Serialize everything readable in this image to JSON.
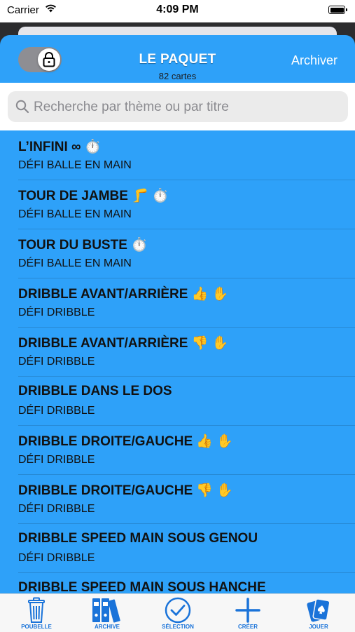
{
  "status_bar": {
    "carrier": "Carrier",
    "time": "4:09 PM"
  },
  "header": {
    "title": "LE PAQUET",
    "subtitle": "82 cartes",
    "archive_label": "Archiver",
    "lock_toggle_on": true
  },
  "search": {
    "placeholder": "Recherche par thème ou par titre"
  },
  "cards": [
    {
      "title": "L’INFINI ∞",
      "emoji": "⏱️",
      "category": "DÉFI BALLE EN MAIN"
    },
    {
      "title": "TOUR DE JAMBE",
      "emoji": "🦵 ⏱️",
      "category": "DÉFI BALLE EN MAIN"
    },
    {
      "title": "TOUR DU BUSTE",
      "emoji": "⏱️",
      "category": "DÉFI BALLE EN MAIN"
    },
    {
      "title": "DRIBBLE AVANT/ARRIÈRE",
      "emoji": "👍 ✋",
      "category": "DÉFI DRIBBLE"
    },
    {
      "title": "DRIBBLE AVANT/ARRIÈRE",
      "emoji": "👎 ✋",
      "category": "DÉFI DRIBBLE"
    },
    {
      "title": "DRIBBLE DANS LE DOS",
      "emoji": "",
      "category": "DÉFI DRIBBLE"
    },
    {
      "title": "DRIBBLE DROITE/GAUCHE",
      "emoji": "👍 ✋",
      "category": "DÉFI DRIBBLE"
    },
    {
      "title": "DRIBBLE DROITE/GAUCHE",
      "emoji": "👎 ✋",
      "category": "DÉFI DRIBBLE"
    },
    {
      "title": "DRIBBLE SPEED MAIN SOUS GENOU",
      "emoji": "",
      "category": "DÉFI DRIBBLE"
    },
    {
      "title": "DRIBBLE SPEED MAIN SOUS HANCHE",
      "emoji": "",
      "category": ""
    }
  ],
  "tabbar": {
    "trash": "POUBELLE",
    "archive": "ARCHIVE",
    "selection": "SÉLECTION",
    "create": "CRÉER",
    "play": "JOUER",
    "accent_color": "#1a73d9"
  },
  "colors": {
    "sheet": "#2ea1f9"
  }
}
